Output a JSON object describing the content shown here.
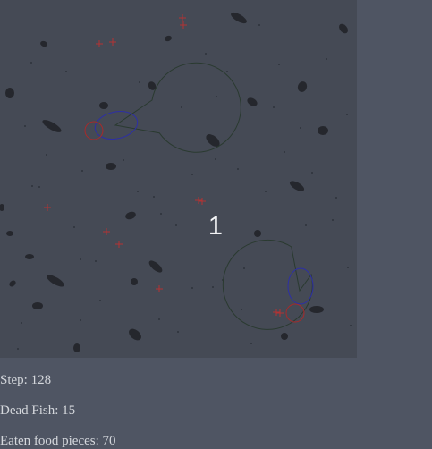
{
  "colors": {
    "page_background": "#4f5563",
    "tank_background": "#454a55",
    "stat_text": "#d4d7dc",
    "rock": "#25272d",
    "food": "#b23333",
    "fov_outline": "#2a3a30",
    "body_outline": "#2d2fa5",
    "mouth_outline": "#a82a2a",
    "overlay_text": "#f3f4f6"
  },
  "tank": {
    "overlay_number": "1"
  },
  "stats": {
    "step": "Step: 128",
    "dead_fish": "Dead Fish: 15",
    "eaten_food": "Eaten food pieces: 70"
  },
  "legend": {
    "rock_icon": "rock-icon",
    "food_icon": "food-cross-icon",
    "fish_icon": "fish-fov-icon"
  }
}
